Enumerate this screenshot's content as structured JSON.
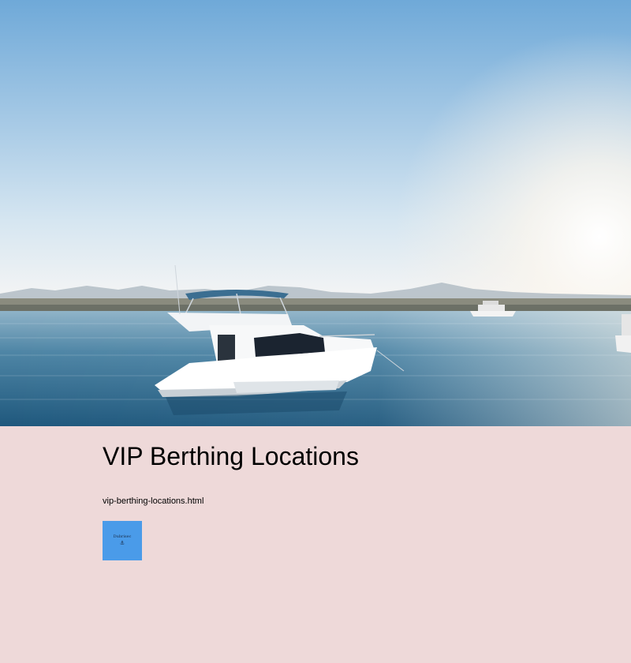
{
  "hero": {
    "scene": "yacht-on-sea-photo"
  },
  "page": {
    "title": "VIP Berthing Locations",
    "file_link": "vip-berthing-locations.html"
  },
  "tile": {
    "label": "Dubrisec",
    "icon": "anchor-icon",
    "icon_glyph": "⚓",
    "color": "#4a9be9"
  },
  "colors": {
    "page_background": "#eed9d9"
  }
}
